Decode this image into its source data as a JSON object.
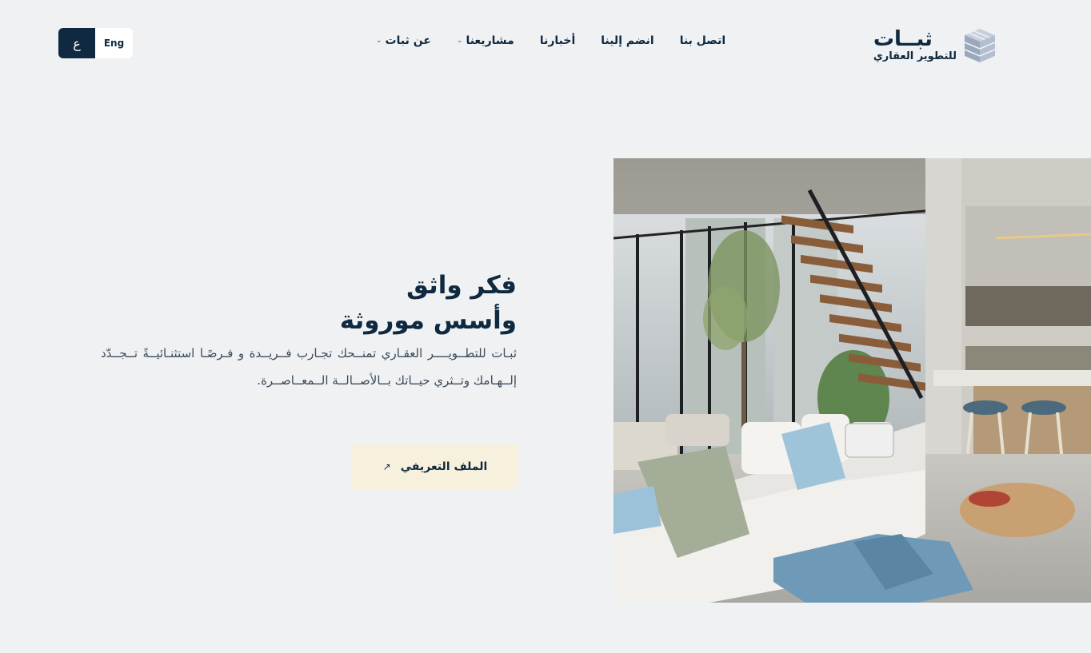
{
  "lang": {
    "arabic_label": "ع",
    "english_label": "Eng"
  },
  "nav": {
    "items": [
      {
        "label": "عن ثبات",
        "has_dropdown": true
      },
      {
        "label": "مشاريعنا",
        "has_dropdown": true
      },
      {
        "label": "أخبارنا",
        "has_dropdown": false
      },
      {
        "label": "انضم إلينا",
        "has_dropdown": false
      },
      {
        "label": "اتصل بنا",
        "has_dropdown": false
      }
    ]
  },
  "logo": {
    "name": "ثبــات",
    "subtitle": "للتطوير العقاري"
  },
  "hero": {
    "title_line1": "فكر واثق",
    "title_line2": "وأسس موروثة",
    "description": "ثبـات للتطــويــــر العقـاري تمنــحك تجـارب فــريــدة  و فـرصًـا استثنـائيــةً تــجــدّد إلــهـامك وتــثري حيــاتك بــالأصــالــة الــمعــاصــرة.",
    "cta_label": "الملف التعريفي"
  },
  "colors": {
    "navy": "#0f2940",
    "cream": "#f6f0dc",
    "background": "#eff1f3"
  }
}
